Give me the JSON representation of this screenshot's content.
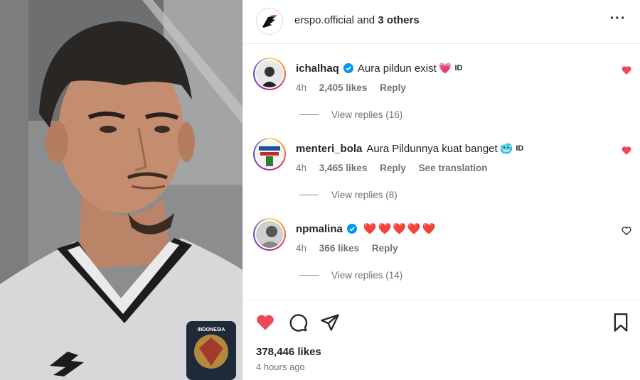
{
  "post": {
    "author": "erspo.official",
    "author_suffix": "and",
    "others": "3 others",
    "more_icon": "more-horizontal-icon"
  },
  "comments": [
    {
      "username": "ichalhaq",
      "verified": true,
      "text": "Aura pildun exist",
      "emoji": "💗",
      "lang_tag": "ID",
      "time": "4h",
      "likes": "2,405 likes",
      "reply": "Reply",
      "translation": "",
      "liked": true,
      "replies_label": "View replies (16)"
    },
    {
      "username": "menteri_bola",
      "verified": false,
      "text": "Aura Pildunnya kuat banget",
      "emoji": "🥶",
      "lang_tag": "ID",
      "time": "4h",
      "likes": "3,465 likes",
      "reply": "Reply",
      "translation": "See translation",
      "liked": true,
      "replies_label": "View replies (8)"
    },
    {
      "username": "npmalina",
      "verified": true,
      "text": "",
      "emoji": "❤️❤️❤️❤️❤️",
      "lang_tag": "",
      "time": "4h",
      "likes": "366 likes",
      "reply": "Reply",
      "translation": "",
      "liked": false,
      "replies_label": "View replies (14)"
    }
  ],
  "footer": {
    "likes": "378,446 likes",
    "time_ago": "4 hours ago",
    "liked": true
  },
  "photo": {
    "badge_text": "INDONESIA"
  },
  "colors": {
    "like_red": "#ed4956",
    "verified_blue": "#0095f6",
    "muted": "#737373"
  }
}
